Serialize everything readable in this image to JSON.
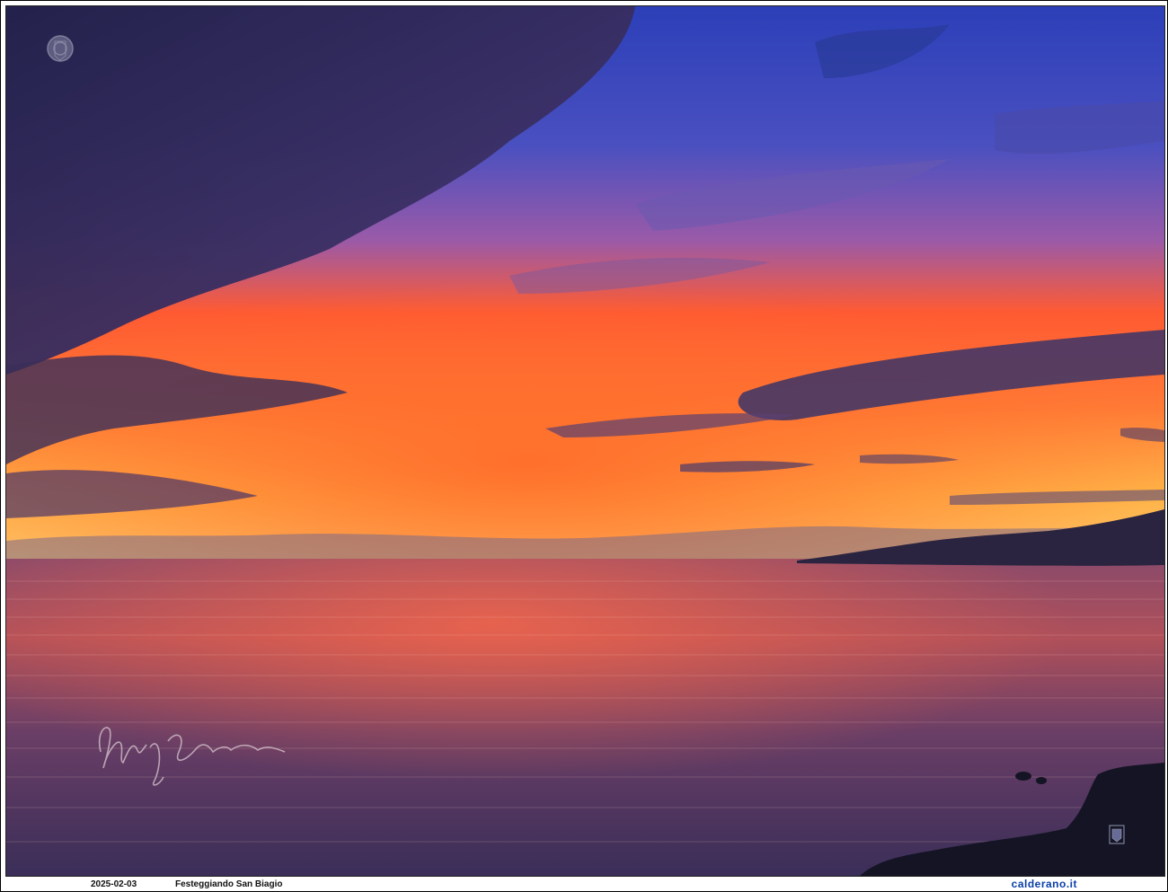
{
  "caption": {
    "date": "2025-02-03",
    "title": "Festeggiando San Biagio",
    "site": "calderano.it"
  },
  "photo": {
    "subject": "sunset over the sea",
    "colors": {
      "sky_top": "#2d46c8",
      "sky_dark_cloud": "#2a2750",
      "sky_glow": "#ff5a2a",
      "horizon": "#ffb347",
      "sea": "#5a3a5e",
      "land": "#1c1a2a"
    }
  },
  "watermarks": {
    "crest": "crest-logo",
    "signature": "M. Calderano",
    "corner_mark": "coat-of-arms"
  }
}
